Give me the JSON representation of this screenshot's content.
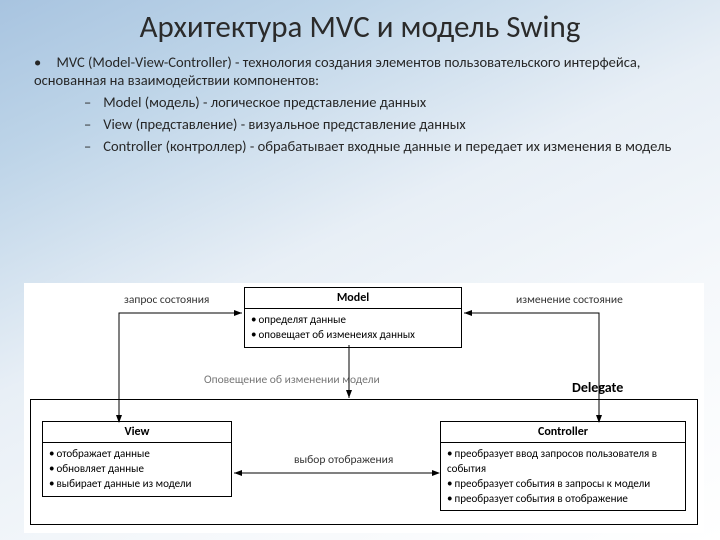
{
  "title": "Архитектура MVC и модель Swing",
  "lead": "MVC (Model-View-Controller) - технология создания элементов пользовательского интерфейса, основанная на взаимодействии компонентов:",
  "bullets": {
    "model": "Model (модель) - логическое представление данных",
    "view": "View (представление) - визуальное представление данных",
    "controller": "Controller (контроллер) - обрабатывает входные данные и передает их изменения в модель"
  },
  "diagram": {
    "model": {
      "title": "Model",
      "items": [
        "определят данные",
        "оповещает об изменеиях данных"
      ]
    },
    "view": {
      "title": "View",
      "items": [
        "отображает данные",
        "обновляет данные",
        "выбирает данные из модели"
      ]
    },
    "controller": {
      "title": "Controller",
      "items": [
        "преобразует ввод запросов пользователя в события",
        "преобразует события в запросы к модели",
        "преобразует события в отображение"
      ]
    },
    "delegate_label": "Delegate",
    "edges": {
      "zapros_sostoyaniya": "запрос состояния",
      "izmenenie_sostoyanie": "изменение состояние",
      "opoveshchenie": "Оповещение об изменении модели",
      "vybor_otobrazheniya": "выбор отображения"
    }
  }
}
